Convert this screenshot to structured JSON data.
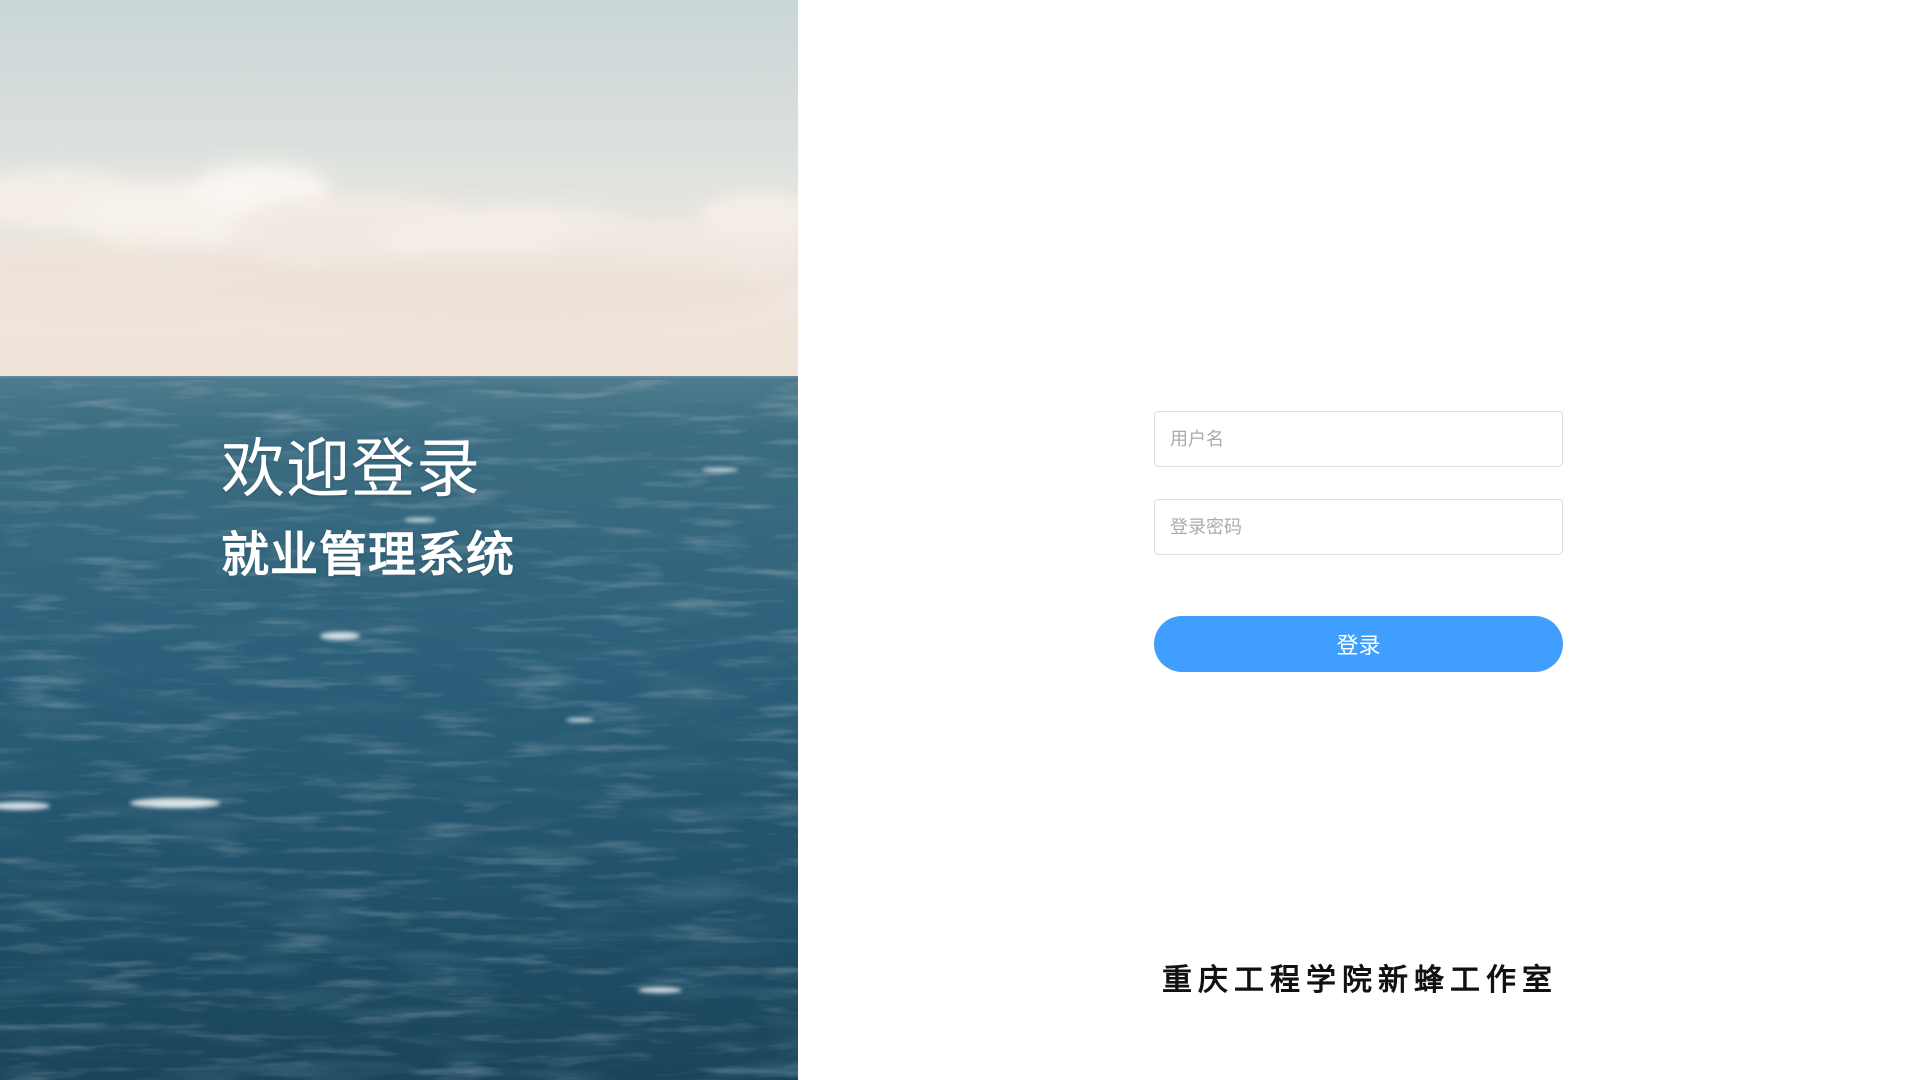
{
  "hero": {
    "welcome_title": "欢迎登录",
    "system_name": "就业管理系统"
  },
  "login": {
    "username_placeholder": "用户名",
    "username_value": "",
    "password_placeholder": "登录密码",
    "password_value": "",
    "submit_label": "登录"
  },
  "footer": {
    "studio_name": "重庆工程学院新蜂工作室"
  },
  "colors": {
    "primary": "#409eff",
    "input_border": "#dcdfe6",
    "sea_dark": "#1f4d63",
    "sky": "#d3dde0"
  }
}
